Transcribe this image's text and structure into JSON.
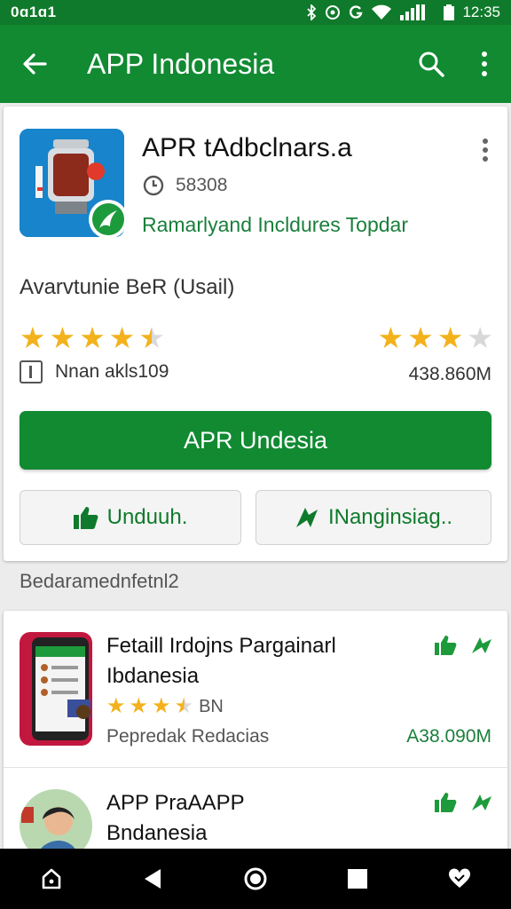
{
  "status_bar": {
    "left": "0ɑ1ɑ1",
    "time": "12:35"
  },
  "app_bar": {
    "title": "APP Indonesia"
  },
  "app": {
    "name": "APR tAdbclnars.a",
    "size": "58308",
    "developer": "Ramarlyand Incldures Topdar",
    "availability": "Avarvtunie BeR (Usail)",
    "rating_left": 4.5,
    "rating_right": 3.5,
    "info": "Nnan akls109",
    "downloads": "438.860M",
    "install_label": "APR Undesia",
    "like_label": "Unduuh.",
    "share_label": "INanginsiag.."
  },
  "section_title": "Bedaramednfetnl2",
  "list": [
    {
      "title_line1": "Fetaill Irdojns Pargainarl",
      "title_line2": "Ibdanesia",
      "rating": 3.5,
      "rating_label": "BN",
      "developer": "Pepredak Redacias",
      "size": "A38.090M"
    },
    {
      "title_line1": "APP PraAAPP",
      "title_line2": "Bndanesia"
    }
  ],
  "colors": {
    "primary": "#118a32",
    "status": "#0f7a2b",
    "accent_text": "#1a7f3c",
    "star": "#f3b21c"
  },
  "icons": [
    "back-arrow-icon",
    "search-icon",
    "more-vert-icon",
    "clock-icon",
    "info-icon",
    "thumb-up-icon",
    "share-icon",
    "home-icon",
    "back-icon",
    "recent-icon",
    "heart-icon"
  ]
}
